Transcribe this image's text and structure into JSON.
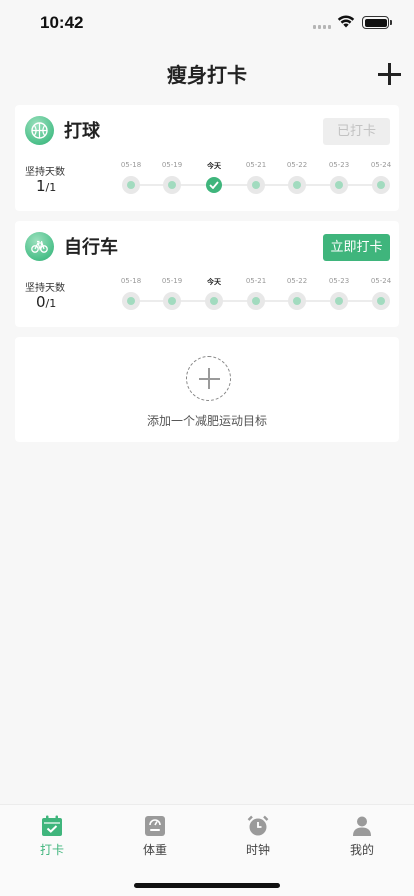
{
  "status_bar": {
    "time": "10:42"
  },
  "nav": {
    "title": "瘦身打卡"
  },
  "goals": [
    {
      "name": "打球",
      "icon": "basketball-icon",
      "button_label": "已打卡",
      "button_state": "done",
      "streak_label": "坚持天数",
      "streak_value": "1",
      "streak_total": "/1"
    },
    {
      "name": "自行车",
      "icon": "bicycle-icon",
      "button_label": "立即打卡",
      "button_state": "active",
      "streak_label": "坚持天数",
      "streak_value": "0",
      "streak_total": "/1"
    }
  ],
  "days": [
    "05-18",
    "05-19",
    "今天",
    "05-21",
    "05-22",
    "05-23",
    "05-24"
  ],
  "add_goal": {
    "label": "添加一个减肥运动目标"
  },
  "tabs": [
    {
      "label": "打卡",
      "icon": "calendar-check-icon",
      "active": true
    },
    {
      "label": "体重",
      "icon": "scale-icon",
      "active": false
    },
    {
      "label": "时钟",
      "icon": "alarm-clock-icon",
      "active": false
    },
    {
      "label": "我的",
      "icon": "person-icon",
      "active": false
    }
  ],
  "colors": {
    "accent": "#3fb57c",
    "dot": "#a2dbbf",
    "background": "#f7f7f7"
  }
}
